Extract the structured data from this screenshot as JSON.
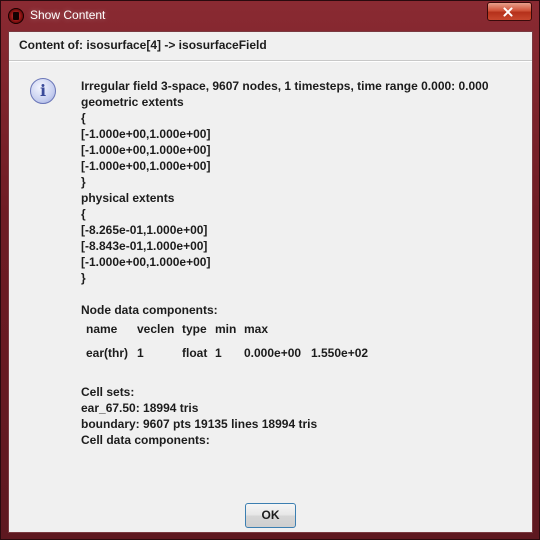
{
  "window": {
    "title": "Show Content",
    "close_label": "Close"
  },
  "header": {
    "content_of": "Content of: isosurface[4] -> isosurfaceField"
  },
  "message": {
    "lines": [
      "Irregular field 3-space, 9607 nodes, 1 timesteps, time range 0.000: 0.000",
      "geometric extents",
      "{",
      "[-1.000e+00,1.000e+00]",
      "[-1.000e+00,1.000e+00]",
      "[-1.000e+00,1.000e+00]",
      "}",
      "physical extents",
      "{",
      "[-8.265e-01,1.000e+00]",
      "[-8.843e-01,1.000e+00]",
      "[-1.000e+00,1.000e+00]",
      "}",
      "",
      "Node data components:"
    ]
  },
  "node_components": {
    "headers": [
      "name",
      "veclen",
      "type",
      "min",
      "max"
    ],
    "rows": [
      [
        "ear(thr)",
        "1",
        "float",
        "1",
        "0.000e+00",
        "1.550e+02"
      ]
    ]
  },
  "cells": {
    "lines": [
      "Cell sets:",
      "ear_67.50: 18994 tris",
      "boundary: 9607 pts 19135 lines 18994 tris",
      "Cell data components:"
    ]
  },
  "buttons": {
    "ok_label": "OK"
  },
  "icons": {
    "app": "app-icon",
    "info": "info-icon",
    "close": "close-icon"
  }
}
